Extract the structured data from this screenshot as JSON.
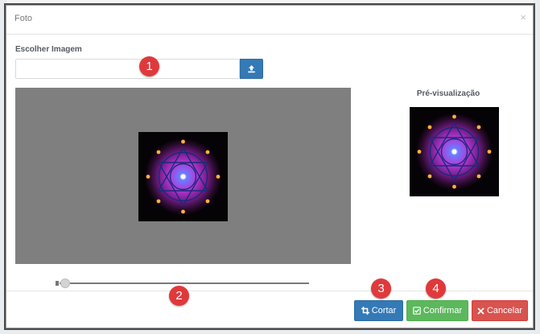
{
  "modal": {
    "title": "Foto",
    "close_glyph": "×"
  },
  "image_field": {
    "label": "Escolher Imagem",
    "value": "",
    "upload_icon": "upload-icon"
  },
  "preview": {
    "title": "Pré-visualização"
  },
  "zoom": {
    "level": 0.0
  },
  "markers": [
    "1",
    "2",
    "3",
    "4"
  ],
  "buttons": {
    "crop_label": "Cortar",
    "confirm_label": "Confirmar",
    "cancel_label": "Cancelar",
    "crop_icon": "crop-icon",
    "confirm_icon": "check-square-icon",
    "cancel_icon": "x-icon"
  },
  "colors": {
    "primary": "#337ab7",
    "success": "#5cb85c",
    "danger": "#d9534f",
    "marker": "#e0393b",
    "crop_background": "#7f7f7f"
  }
}
